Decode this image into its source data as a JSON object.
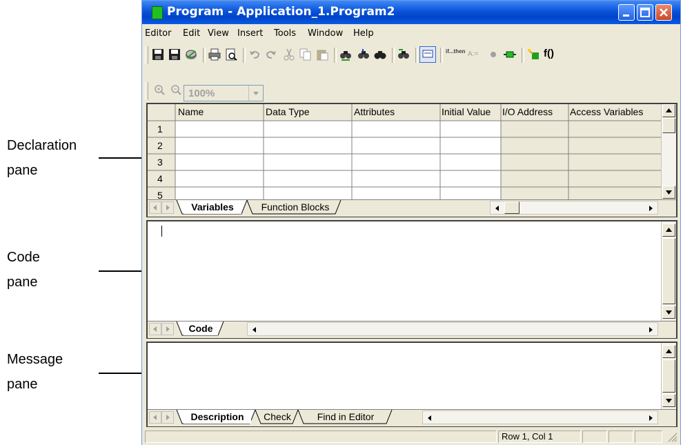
{
  "callouts": {
    "declaration": [
      "Declaration",
      "pane"
    ],
    "code": [
      "Code",
      "pane"
    ],
    "message": [
      "Message",
      "pane"
    ]
  },
  "window": {
    "title": "Program - Application_1.Program2",
    "buttons": [
      "minimize",
      "maximize",
      "close"
    ]
  },
  "menu": [
    "Editor",
    "Edit",
    "View",
    "Insert",
    "Tools",
    "Window",
    "Help"
  ],
  "toolbar1": [
    "save-icon",
    "save-all-icon",
    "save-disk-icon",
    "print-icon",
    "print-preview-icon",
    "undo-icon",
    "redo-icon",
    "cut-icon",
    "copy-icon",
    "paste-icon",
    "find-icon",
    "find-next-icon",
    "binoculars-icon",
    "replace-icon",
    "monitor-icon",
    "if-then-icon",
    "assign-icon",
    "breakpoint-icon",
    "step-icon",
    "insert-fb-icon",
    "function-icon"
  ],
  "toolbar1_labels": {
    "if_then": "if...then",
    "assign": "A:=",
    "func": "f()"
  },
  "toolbar2": {
    "zoom_value": "100%"
  },
  "declaration": {
    "columns": [
      "Name",
      "Data Type",
      "Attributes",
      "Initial Value",
      "I/O Address",
      "Access Variables"
    ],
    "rows": [
      "1",
      "2",
      "3",
      "4",
      "5"
    ],
    "tabs": [
      "Variables",
      "Function Blocks"
    ]
  },
  "code": {
    "tabs": [
      "Code"
    ]
  },
  "message": {
    "tabs": [
      "Description",
      "Check",
      "Find in Editor"
    ]
  },
  "status": {
    "position": "Row 1, Col 1"
  },
  "colors": {
    "title_blue": "#0a53d8",
    "face": "#ece9d8",
    "readonly_cell": "#ece9d8"
  }
}
